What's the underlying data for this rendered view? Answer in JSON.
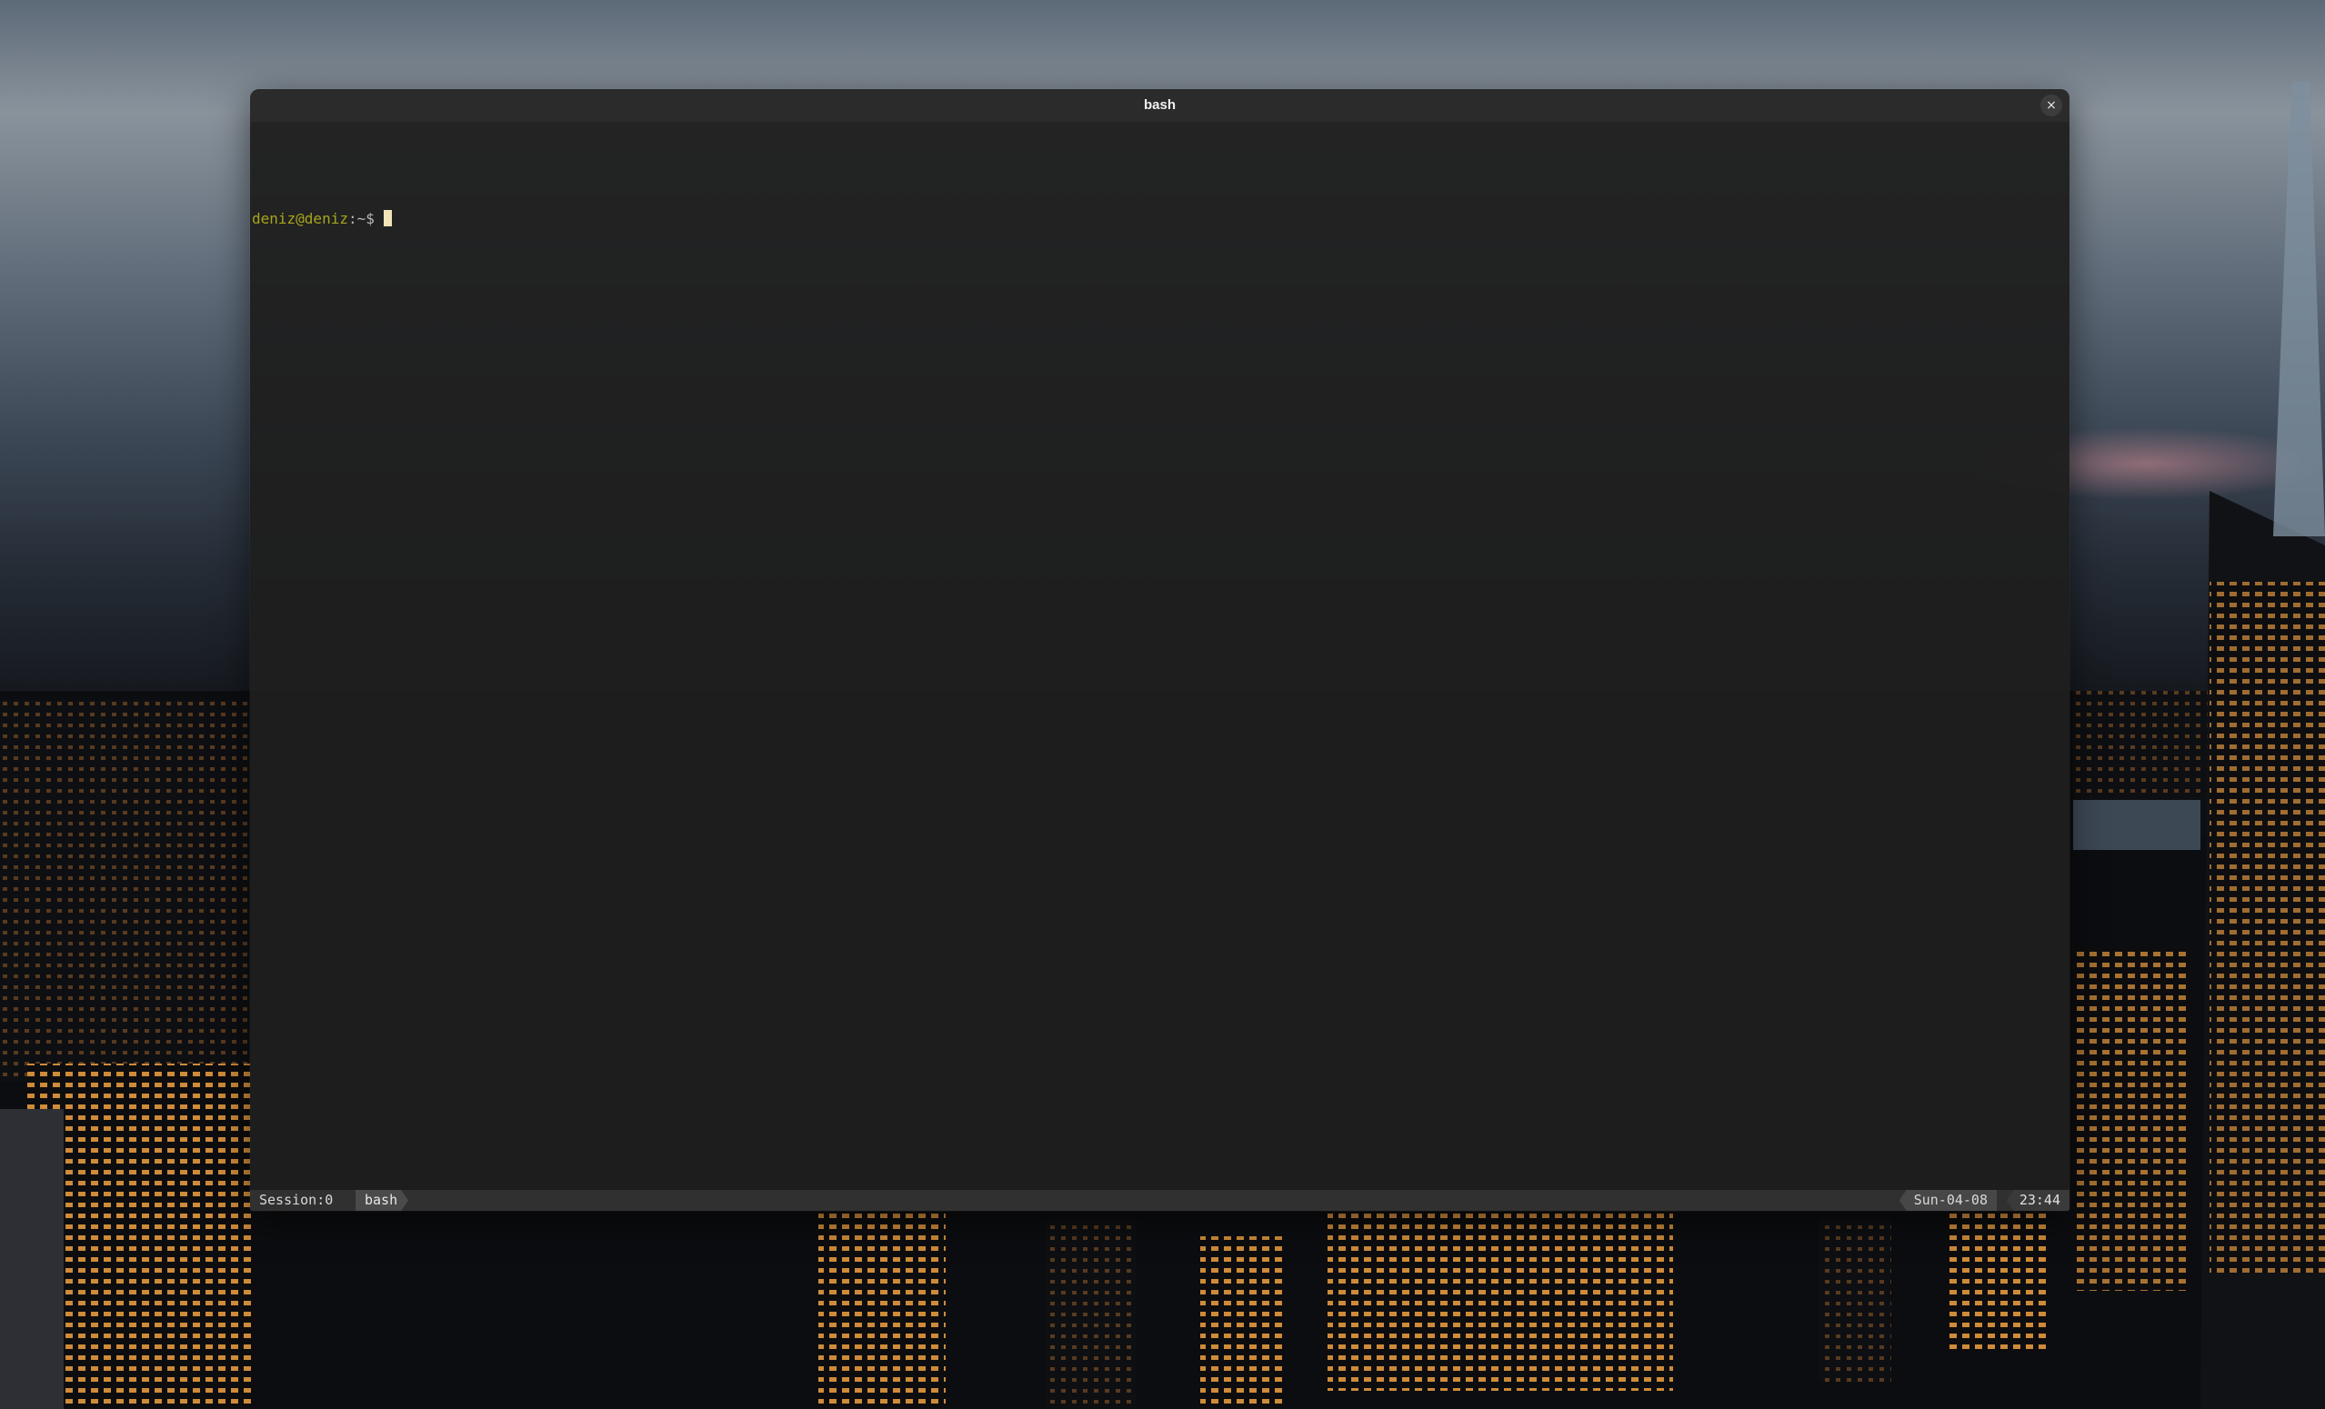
{
  "window": {
    "title": "bash",
    "close_icon": "close-icon",
    "close_glyph": "×"
  },
  "terminal": {
    "prompt_user_host": "deniz@deniz",
    "prompt_path": ":~$ "
  },
  "statusbar": {
    "session": "Session:0",
    "window_name": "bash",
    "date": "Sun-04-08",
    "time": "23:44"
  },
  "colors": {
    "prompt_user": "#a7a51b",
    "cursor": "#f2e3b8",
    "terminal_bg": "#1e1e1e"
  }
}
